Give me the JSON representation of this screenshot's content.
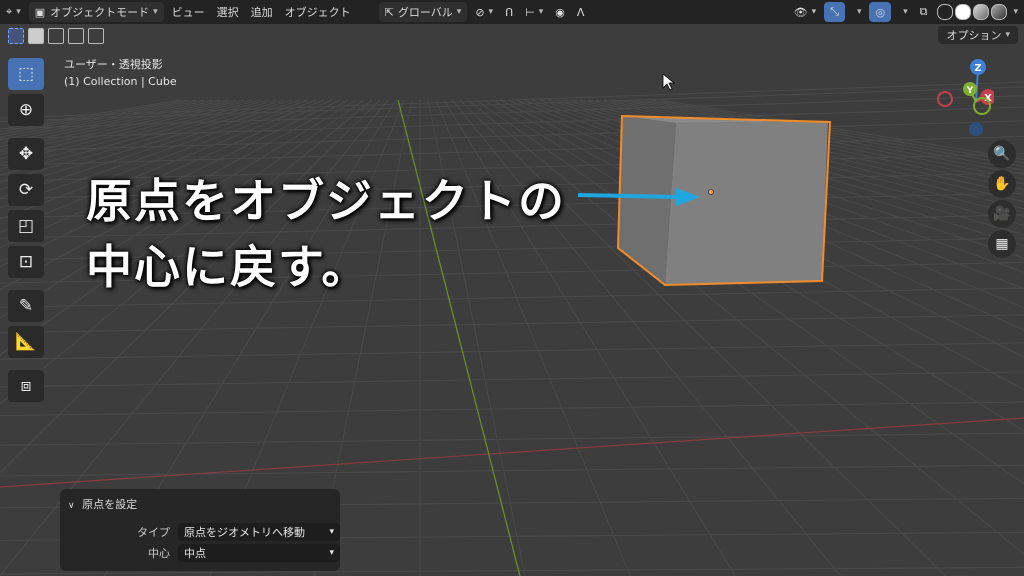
{
  "menu": {
    "mode_label": "オブジェクトモード",
    "items": [
      "ビュー",
      "選択",
      "追加",
      "オブジェクト"
    ],
    "transform_orientation": "グローバル"
  },
  "header": {
    "options_label": "オプション"
  },
  "viewport": {
    "view_name": "ユーザー・透視投影",
    "collection_info": "(1) Collection | Cube"
  },
  "gizmo": {
    "z": "Z",
    "y": "Y",
    "x": "X"
  },
  "caption": {
    "line1": "原点をオブジェクトの",
    "line2": "中心に戻す。"
  },
  "operator_panel": {
    "title": "原点を設定",
    "type_label": "タイプ",
    "type_value": "原点をジオメトリへ移動",
    "center_label": "中心",
    "center_value": "中点"
  },
  "colors": {
    "accent": "#4772b3",
    "selection_outline": "#f28c28",
    "arrow": "#1fa6e0",
    "x_axis": "#c4404d",
    "y_axis": "#7fae2c",
    "z_axis": "#3d7fd6"
  }
}
